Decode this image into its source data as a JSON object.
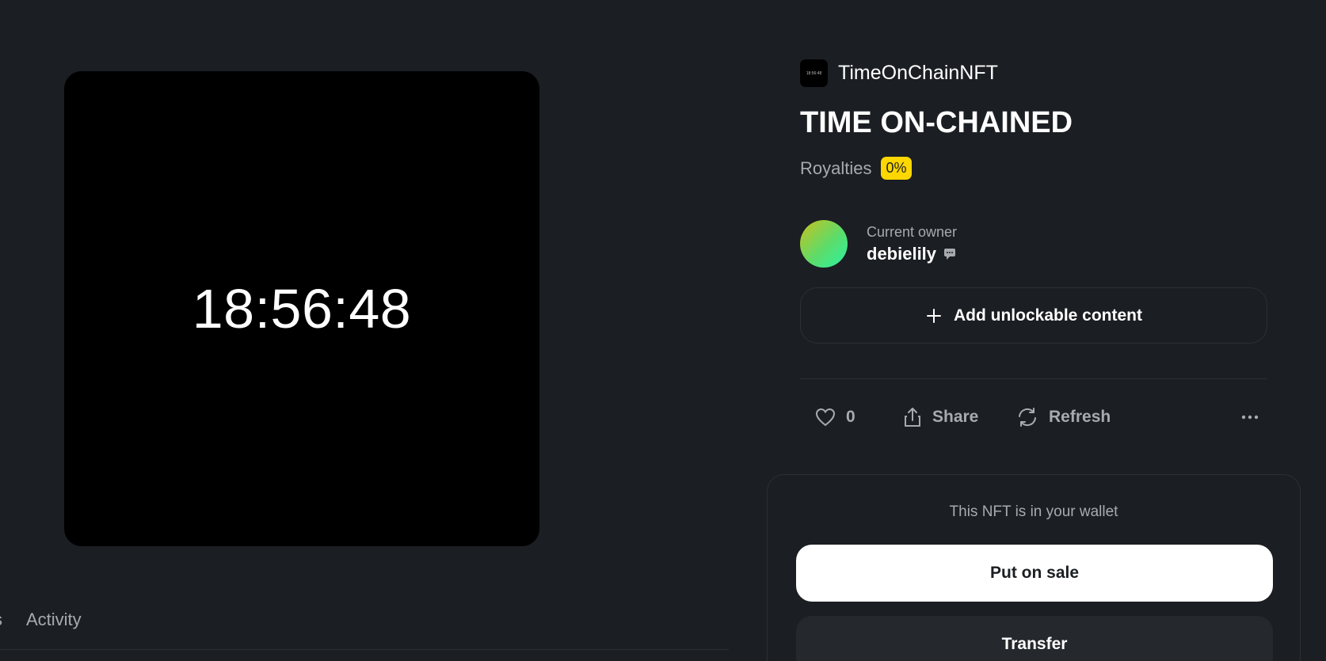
{
  "preview": {
    "clock_text": "18:56:48"
  },
  "tabs": {
    "partial": "s",
    "activity": "Activity"
  },
  "collection": {
    "logo_text": "18:56:48",
    "name": "TimeOnChainNFT"
  },
  "item": {
    "title": "TIME ON-CHAINED",
    "royalties_label": "Royalties",
    "royalties_value": "0%"
  },
  "owner": {
    "label": "Current owner",
    "name": "debielily"
  },
  "unlockable": {
    "label": "Add unlockable content"
  },
  "actions": {
    "likes": "0",
    "share": "Share",
    "refresh": "Refresh"
  },
  "wallet": {
    "note": "This NFT is in your wallet",
    "sale_button": "Put on sale",
    "transfer_button": "Transfer"
  },
  "colors": {
    "background": "#1b1e22",
    "badge": "#fed700",
    "muted_text": "#a7abb0",
    "avatar_gradient_start": "#c8c11d",
    "avatar_gradient_end": "#2af2a2"
  }
}
